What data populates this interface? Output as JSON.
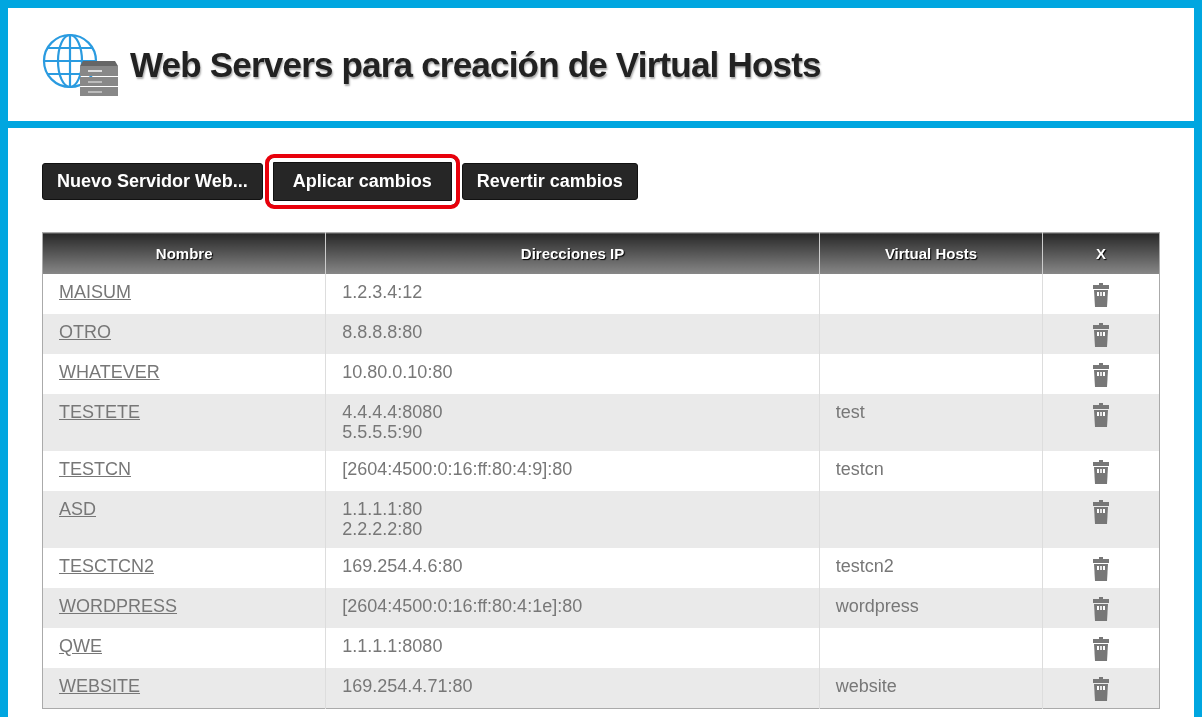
{
  "header": {
    "title": "Web Servers para creación de Virtual Hosts"
  },
  "buttons": [
    {
      "label": "Nuevo Servidor Web...",
      "highlighted": false
    },
    {
      "label": "Aplicar cambios",
      "highlighted": true
    },
    {
      "label": "Revertir cambios",
      "highlighted": false
    }
  ],
  "table": {
    "columns": [
      "Nombre",
      "Direcciones IP",
      "Virtual Hosts",
      "X"
    ],
    "rows": [
      {
        "name": "MAISUM",
        "ips": [
          "1.2.3.4:12"
        ],
        "virtual_hosts": ""
      },
      {
        "name": "OTRO",
        "ips": [
          "8.8.8.8:80"
        ],
        "virtual_hosts": ""
      },
      {
        "name": "WHATEVER",
        "ips": [
          "10.80.0.10:80"
        ],
        "virtual_hosts": ""
      },
      {
        "name": "TESTETE",
        "ips": [
          "4.4.4.4:8080",
          "5.5.5.5:90"
        ],
        "virtual_hosts": "test"
      },
      {
        "name": "TESTCN",
        "ips": [
          "[2604:4500:0:16:ff:80:4:9]:80"
        ],
        "virtual_hosts": "testcn"
      },
      {
        "name": "ASD",
        "ips": [
          "1.1.1.1:80",
          "2.2.2.2:80"
        ],
        "virtual_hosts": ""
      },
      {
        "name": "TESCTCN2",
        "ips": [
          "169.254.4.6:80"
        ],
        "virtual_hosts": "testcn2"
      },
      {
        "name": "WORDPRESS",
        "ips": [
          "[2604:4500:0:16:ff:80:4:1e]:80"
        ],
        "virtual_hosts": "wordpress"
      },
      {
        "name": "QWE",
        "ips": [
          "1.1.1.1:8080"
        ],
        "virtual_hosts": ""
      },
      {
        "name": "WEBSITE",
        "ips": [
          "169.254.4.71:80"
        ],
        "virtual_hosts": "website"
      }
    ]
  }
}
